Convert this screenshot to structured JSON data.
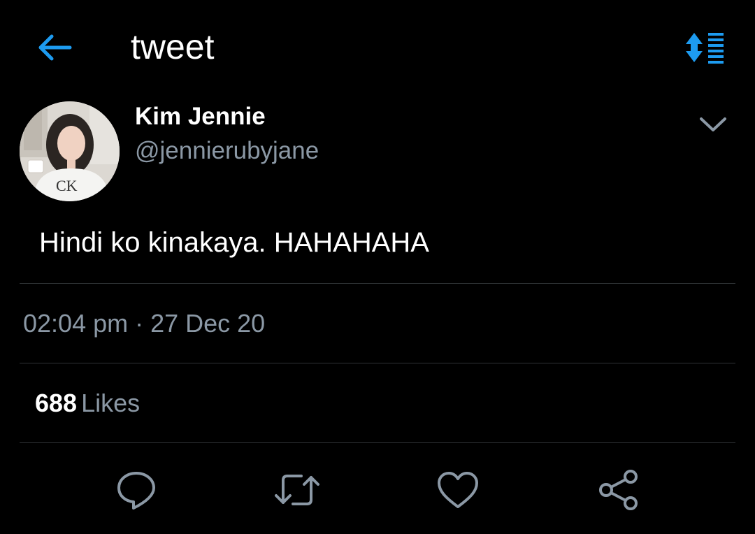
{
  "header": {
    "title": "tweet",
    "back_icon": "arrow-left-icon",
    "sort_icon": "sort-list-icon",
    "accent_color": "#1d9bf0"
  },
  "tweet": {
    "author_name": "Kim Jennie",
    "author_handle": "@jennierubyjane",
    "avatar_text": "CK",
    "text": "Hindi ko kinakaya. HAHAHAHA",
    "timestamp": "02:04 pm · 27 Dec 20",
    "likes_count": "688",
    "likes_label": "Likes"
  },
  "actions": [
    {
      "name": "reply",
      "icon": "comment-icon"
    },
    {
      "name": "retweet",
      "icon": "retweet-icon"
    },
    {
      "name": "like",
      "icon": "heart-icon"
    },
    {
      "name": "share",
      "icon": "share-icon"
    }
  ],
  "colors": {
    "background": "#000000",
    "text_primary": "#ffffff",
    "text_secondary": "#8b98a5",
    "divider": "#2f3336",
    "icon_gray": "#8b98a5"
  }
}
